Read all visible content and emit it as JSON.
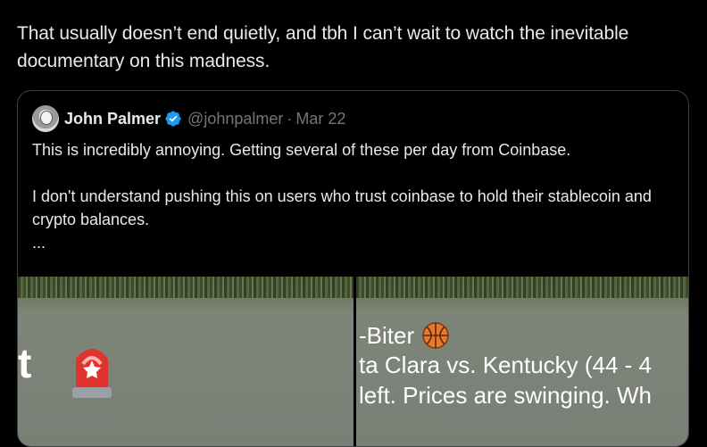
{
  "post": {
    "text": "That usually doesn’t end quietly, and tbh I can’t wait to watch the inevitable documentary on this madness."
  },
  "quote": {
    "author_name": "John Palmer",
    "handle": "@johnpalmer",
    "separator": "·",
    "date": "Mar 22",
    "body_line1": "This is incredibly annoying. Getting several of these per day from Coinbase.",
    "body_line2": "I don't understand pushing this on users who trust coinbase to hold their stablecoin and crypto balances.",
    "ellipsis": "..."
  },
  "media": {
    "image1_text": "t",
    "image2_line1": "-Biter",
    "image2_line2": "ta Clara vs. Kentucky (44 - 4",
    "image2_line3": "left. Prices are swinging. Wh"
  },
  "icons": {
    "verified": "verified-badge-icon",
    "siren": "siren-emoji-icon",
    "basketball": "basketball-emoji-icon"
  },
  "colors": {
    "background": "#000000",
    "text": "#e7e9ea",
    "secondary": "#71767b",
    "verified": "#1d9bf0",
    "border": "#3e4144"
  }
}
